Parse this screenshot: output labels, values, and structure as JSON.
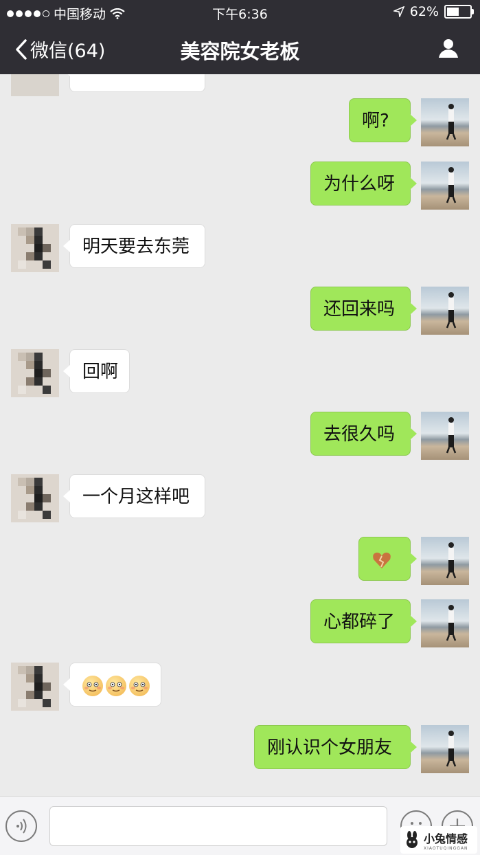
{
  "status_bar": {
    "carrier": "中国移动",
    "time": "下午6:36",
    "battery": "62%",
    "battery_level": 0.62
  },
  "nav": {
    "back_label": "微信(64)",
    "title": "美容院女老板"
  },
  "messages": [
    {
      "from": "me",
      "text": "啊?"
    },
    {
      "from": "me",
      "text": "为什么呀"
    },
    {
      "from": "other",
      "text": "明天要去东莞"
    },
    {
      "from": "me",
      "text": "还回来吗"
    },
    {
      "from": "other",
      "text": "回啊"
    },
    {
      "from": "me",
      "text": "去很久吗"
    },
    {
      "from": "other",
      "text": "一个月这样吧"
    },
    {
      "from": "me",
      "text": "",
      "sticker": "broken-heart-icon"
    },
    {
      "from": "me",
      "text": "心都碎了"
    },
    {
      "from": "other",
      "text": "",
      "stickers": [
        "blushing-face-icon",
        "blushing-face-icon",
        "blushing-face-icon"
      ]
    },
    {
      "from": "me",
      "text": "刚认识个女朋友"
    }
  ],
  "watermark": {
    "brand": "小兔情感",
    "url": "XIAOTUQINGGAN"
  }
}
